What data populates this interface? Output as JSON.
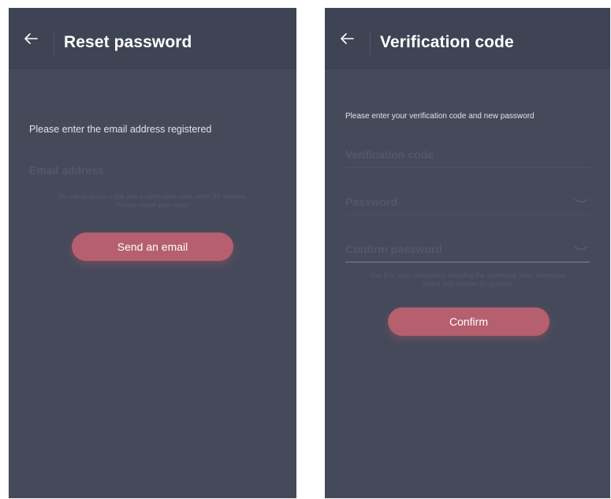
{
  "reset_screen": {
    "title": "Reset password",
    "instruction": "Please enter the email address registered",
    "email": {
      "placeholder": "Email address",
      "value": ""
    },
    "hint_line1": "We will send you a link with a verification code within 30 minutes.",
    "hint_line2": "Please check your email",
    "send_button_label": "Send an email",
    "back_icon": "arrow-left-icon"
  },
  "verify_screen": {
    "title": "Verification code",
    "instruction": "Please enter your verification code and new password",
    "code": {
      "placeholder": "Verification code",
      "value": ""
    },
    "password": {
      "placeholder": "Password",
      "value": ""
    },
    "confirm_password": {
      "placeholder": "Confirm password",
      "value": ""
    },
    "hint_line1": "Use 8 or more characters, including the uppercase letter, lowercase",
    "hint_line2": "letters and number (or symbol).",
    "confirm_button_label": "Confirm",
    "back_icon": "arrow-left-icon",
    "eye_icon": "eye-closed-icon"
  },
  "colors": {
    "background": "#454a5b",
    "header": "#3f4454",
    "accent_button": "#b65f6f",
    "title_text": "#ffffff",
    "placeholder_text": "#535869"
  }
}
